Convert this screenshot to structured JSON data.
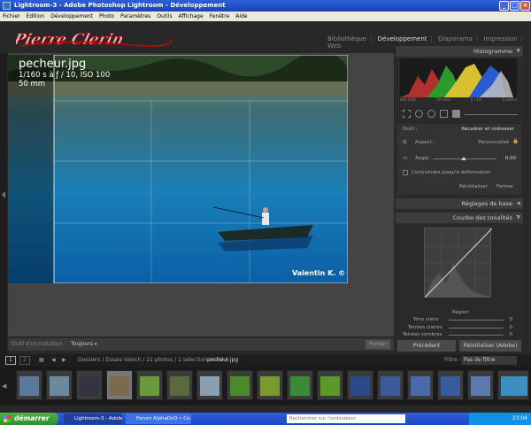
{
  "window": {
    "title": "Lightroom-3 - Adobe Photoshop Lightroom - Développement",
    "min": "_",
    "max": "□",
    "close": "×"
  },
  "menu": [
    "Fichier",
    "Edition",
    "Développement",
    "Photo",
    "Paramètres",
    "Outils",
    "Affichage",
    "Fenêtre",
    "Aide"
  ],
  "identity_plate": "Pierre Clerin",
  "modules": {
    "items": [
      "Bibliothèque",
      "Développement",
      "Diaporama",
      "Impression",
      "Web"
    ],
    "active": "Développement",
    "separator": "|"
  },
  "photo_info": {
    "filename": "pecheur.jpg",
    "exposure": "1/160 s à ƒ / 10, ISO 100",
    "focal": "50 mm"
  },
  "watermark": "Valentin K. ©",
  "toolbar": {
    "overlay_label": "Outil d'incrustation :",
    "overlay_value": "Toujours",
    "close_label": "Fermer"
  },
  "right_panel": {
    "histogram_title": "Histogramme",
    "histo_labels": [
      "ISO 100",
      "50 mm",
      "ƒ / 10",
      "1/160 s"
    ],
    "tool_label": "Outil :",
    "tool_value": "Recadrer et redresser",
    "aspect_label": "Aspect :",
    "aspect_value": "Personnalisé",
    "angle_label": "Angle",
    "angle_value": "0,00",
    "constrain_label": "Contraindre jusqu'à déformation",
    "reset_label": "Réinitialiser",
    "close_label": "Fermer",
    "basic_title": "Réglages de base",
    "curve_title": "Courbe des tonalités",
    "region_label": "Région",
    "regions": [
      {
        "label": "Tons clairs",
        "value": "0"
      },
      {
        "label": "Teintes claires",
        "value": "0"
      },
      {
        "label": "Teintes sombres",
        "value": "0"
      }
    ],
    "previous_btn": "Précédent",
    "reset_adobe_btn": "Réinitialiser (Adobe)"
  },
  "filmstrip": {
    "pages": [
      "1",
      "2"
    ],
    "path_prefix": "Dossiers / Essais Valoch / 21 photos / 1 sélectionnée(s) /",
    "path_file": "pecheur.jpg",
    "filter_label": "Filtre :",
    "filter_value": "Pas de filtre"
  },
  "taskbar": {
    "start": "démarrer",
    "tasks": [
      "Lightroom-3 - Adobe ...",
      "Forum AlphaDvD • Co..."
    ],
    "search_placeholder": "Rechercher sur l'ordinateur",
    "clock": "23:04"
  }
}
